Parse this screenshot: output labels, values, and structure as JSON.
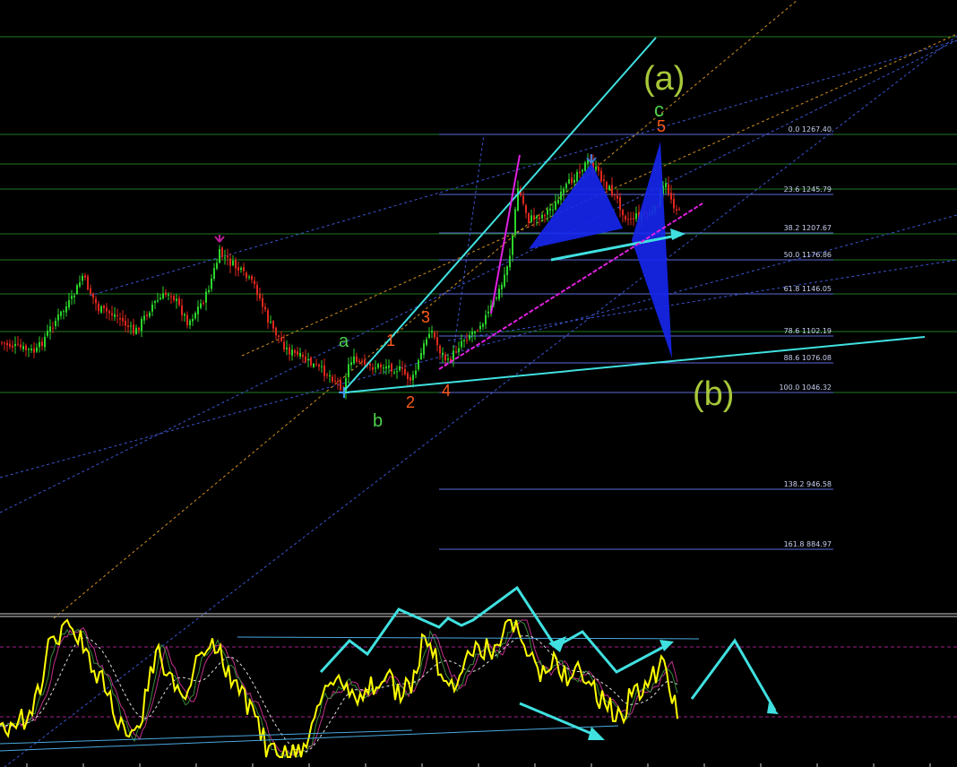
{
  "chart_data": {
    "type": "candlestick",
    "panels": [
      "price",
      "oscillator"
    ],
    "fibonacci_levels": [
      {
        "ratio": "0.0",
        "price": "1267.40"
      },
      {
        "ratio": "23.6",
        "price": "1245.79"
      },
      {
        "ratio": "38.2",
        "price": "1207.67"
      },
      {
        "ratio": "50.0",
        "price": "1176.86"
      },
      {
        "ratio": "61.8",
        "price": "1146.05"
      },
      {
        "ratio": "78.6",
        "price": "1102.19"
      },
      {
        "ratio": "88.6",
        "price": "1076.08"
      },
      {
        "ratio": "100.0",
        "price": "1046.32"
      },
      {
        "ratio": "138.2",
        "price": "946.58"
      },
      {
        "ratio": "161.8",
        "price": "884.97"
      }
    ],
    "wave_labels": {
      "a_small": "a",
      "b_small": "b",
      "c_small": "c",
      "w1": "1",
      "w2": "2",
      "w3": "3",
      "w4": "4",
      "w5": "5",
      "a_big": "(a)",
      "b_big": "(b)"
    },
    "colors": {
      "background": "#000000",
      "bull_candle": "#2bd42b",
      "bear_candle": "#e0281e",
      "oscillator_main": "#ffff00",
      "trendline": "#40e0e0",
      "pattern_fill": "#1626f0",
      "fib_line": "#5a6bd8",
      "green_grid": "#1f7a1f",
      "impulse_label": "#ff5a1a",
      "corrective_label": "#4cd14c",
      "big_label": "#a8c83a",
      "magenta": "#e020e0"
    }
  }
}
